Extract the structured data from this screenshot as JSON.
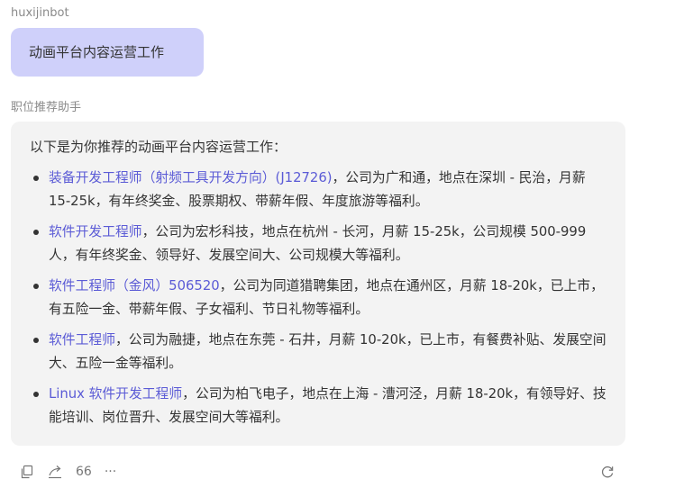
{
  "user": {
    "name": "huxijinbot",
    "message": "动画平台内容运营工作"
  },
  "assistant": {
    "name": "职位推荐助手",
    "intro": "以下是为你推荐的动画平台内容运营工作：",
    "jobs": [
      {
        "title": "装备开发工程师（射频工具开发方向）(J12726)",
        "detail": "，公司为广和通，地点在深圳 - 民治，月薪 15-25k，有年终奖金、股票期权、带薪年假、年度旅游等福利。"
      },
      {
        "title": "软件开发工程师",
        "detail": "，公司为宏杉科技，地点在杭州 - 长河，月薪 15-25k，公司规模 500-999 人，有年终奖金、领导好、发展空间大、公司规模大等福利。"
      },
      {
        "title": "软件工程师（金风）506520",
        "detail": "，公司为同道猎聘集团，地点在通州区，月薪 18-20k，已上市，有五险一金、带薪年假、子女福利、节日礼物等福利。"
      },
      {
        "title": "软件工程师",
        "detail": "，公司为融捷，地点在东莞 - 石井，月薪 10-20k，已上市，有餐费补贴、发展空间大、五险一金等福利。"
      },
      {
        "title": "Linux 软件开发工程师",
        "detail": "，公司为柏飞电子，地点在上海 - 漕河泾，月薪 18-20k，有领导好、技能培训、岗位晋升、发展空间大等福利。"
      }
    ]
  },
  "toolbar": {
    "icons": [
      "copy-icon",
      "share-icon",
      "quote-icon",
      "more-icon",
      "regenerate-icon"
    ],
    "quote_label": "66",
    "more_label": "···"
  },
  "colors": {
    "user_bubble": "#cfd0fa",
    "assistant_bubble": "#f3f3f3",
    "link": "#5b5bd6",
    "text": "#333333",
    "meta": "#8a8a8a"
  }
}
